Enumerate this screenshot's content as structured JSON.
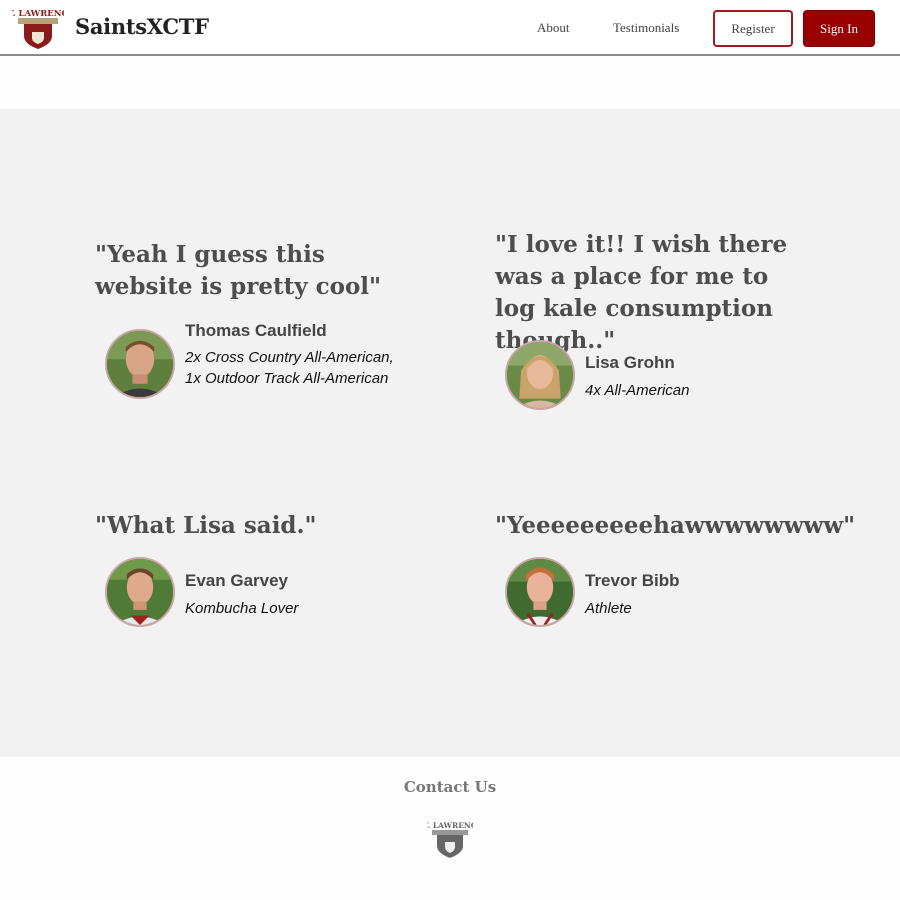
{
  "header": {
    "logo_text": "ST. LAWRENCE",
    "brand": "SaintsXCTF",
    "nav": {
      "about": "About",
      "testimonials": "Testimonials"
    },
    "register_label": "Register",
    "signin_label": "Sign In"
  },
  "testimonials": [
    {
      "quote": "\"Yeah I guess this website is pretty cool\"",
      "name": "Thomas Caulfield",
      "title": "2x Cross Country All-American, 1x Outdoor Track All-American"
    },
    {
      "quote": "\"I love it!! I wish there was a place for me to log kale consumption though..\"",
      "name": "Lisa Grohn",
      "title": "4x All-American"
    },
    {
      "quote": "\"What Lisa said.\"",
      "name": "Evan Garvey",
      "title": "Kombucha Lover"
    },
    {
      "quote": "\"Yeeeeeeeeehawwwwwwww\"",
      "name": "Trevor Bibb",
      "title": "Athlete"
    }
  ],
  "footer": {
    "contact": "Contact Us",
    "logo_text": "ST. LAWRENCE"
  },
  "colors": {
    "accent": "#990000",
    "quote_text": "#4d4d4d",
    "band_bg": "#f2f2f2"
  }
}
